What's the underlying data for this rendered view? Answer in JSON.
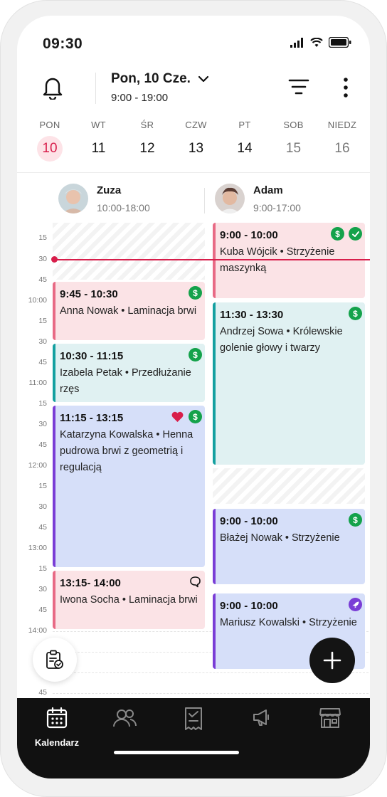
{
  "status_bar": {
    "time": "09:30"
  },
  "header": {
    "date": "Pon, 10 Cze.",
    "hours": "9:00 - 19:00"
  },
  "week": [
    {
      "name": "PON",
      "num": "10",
      "state": "active"
    },
    {
      "name": "WT",
      "num": "11",
      "state": "normal"
    },
    {
      "name": "ŚR",
      "num": "12",
      "state": "normal"
    },
    {
      "name": "CZW",
      "num": "13",
      "state": "normal"
    },
    {
      "name": "PT",
      "num": "14",
      "state": "normal"
    },
    {
      "name": "SOB",
      "num": "15",
      "state": "muted"
    },
    {
      "name": "NIEDZ",
      "num": "16",
      "state": "muted"
    }
  ],
  "staff": [
    {
      "name": "Zuza",
      "hours": "10:00-18:00"
    },
    {
      "name": "Adam",
      "hours": "9:00-17:00"
    }
  ],
  "time_labels": [
    "15",
    "30",
    "45",
    "10:00",
    "15",
    "30",
    "45",
    "11:00",
    "15",
    "30",
    "45",
    "12:00",
    "15",
    "30",
    "45",
    "13:00",
    "15",
    "30",
    "45",
    "14:00",
    "15",
    "30",
    "45"
  ],
  "appointments": {
    "zuza": [
      {
        "time": "9:45 - 10:30",
        "desc": "Anna Nowak • Laminacja brwi",
        "color": "pink",
        "icons": [
          "dollar"
        ]
      },
      {
        "time": "10:30 - 11:15",
        "desc": "Izabela Petak • Przedłużanie rzęs",
        "color": "teal",
        "icons": [
          "dollar"
        ]
      },
      {
        "time": "11:15 - 13:15",
        "desc": "Katarzyna Kowalska • Henna pudrowa brwi z geometrią i regulacją",
        "color": "blue",
        "icons": [
          "heart",
          "dollar"
        ]
      },
      {
        "time": "13:15- 14:00",
        "desc": "Iwona Socha • Laminacja brwi",
        "color": "pink",
        "icons": [
          "comment"
        ]
      }
    ],
    "adam": [
      {
        "time": "9:00 - 10:00",
        "desc": "Kuba Wójcik • Strzyżenie maszynką",
        "color": "pink",
        "icons": [
          "dollar",
          "check"
        ]
      },
      {
        "time": "11:30 - 13:30",
        "desc": "Andrzej Sowa • Królewskie golenie głowy i twarzy",
        "color": "teal",
        "icons": [
          "dollar"
        ]
      },
      {
        "time": "9:00 - 10:00",
        "desc": "Błażej Nowak • Strzyżenie",
        "color": "blue",
        "icons": [
          "dollar"
        ]
      },
      {
        "time": "9:00 - 10:00",
        "desc": "Mariusz Kowalski • Strzyżenie",
        "color": "blue",
        "icons": [
          "rocket"
        ]
      }
    ]
  },
  "bottom_nav": [
    {
      "label": "Kalendarz",
      "icon": "calendar-icon",
      "active": true
    },
    {
      "label": "",
      "icon": "clients-icon",
      "active": false
    },
    {
      "label": "",
      "icon": "receipt-icon",
      "active": false
    },
    {
      "label": "",
      "icon": "megaphone-icon",
      "active": false
    },
    {
      "label": "",
      "icon": "store-icon",
      "active": false
    }
  ],
  "colors": {
    "accent": "#d81e4b",
    "dark": "#111111",
    "green": "#14a24b",
    "purple": "#7a3dd6"
  }
}
